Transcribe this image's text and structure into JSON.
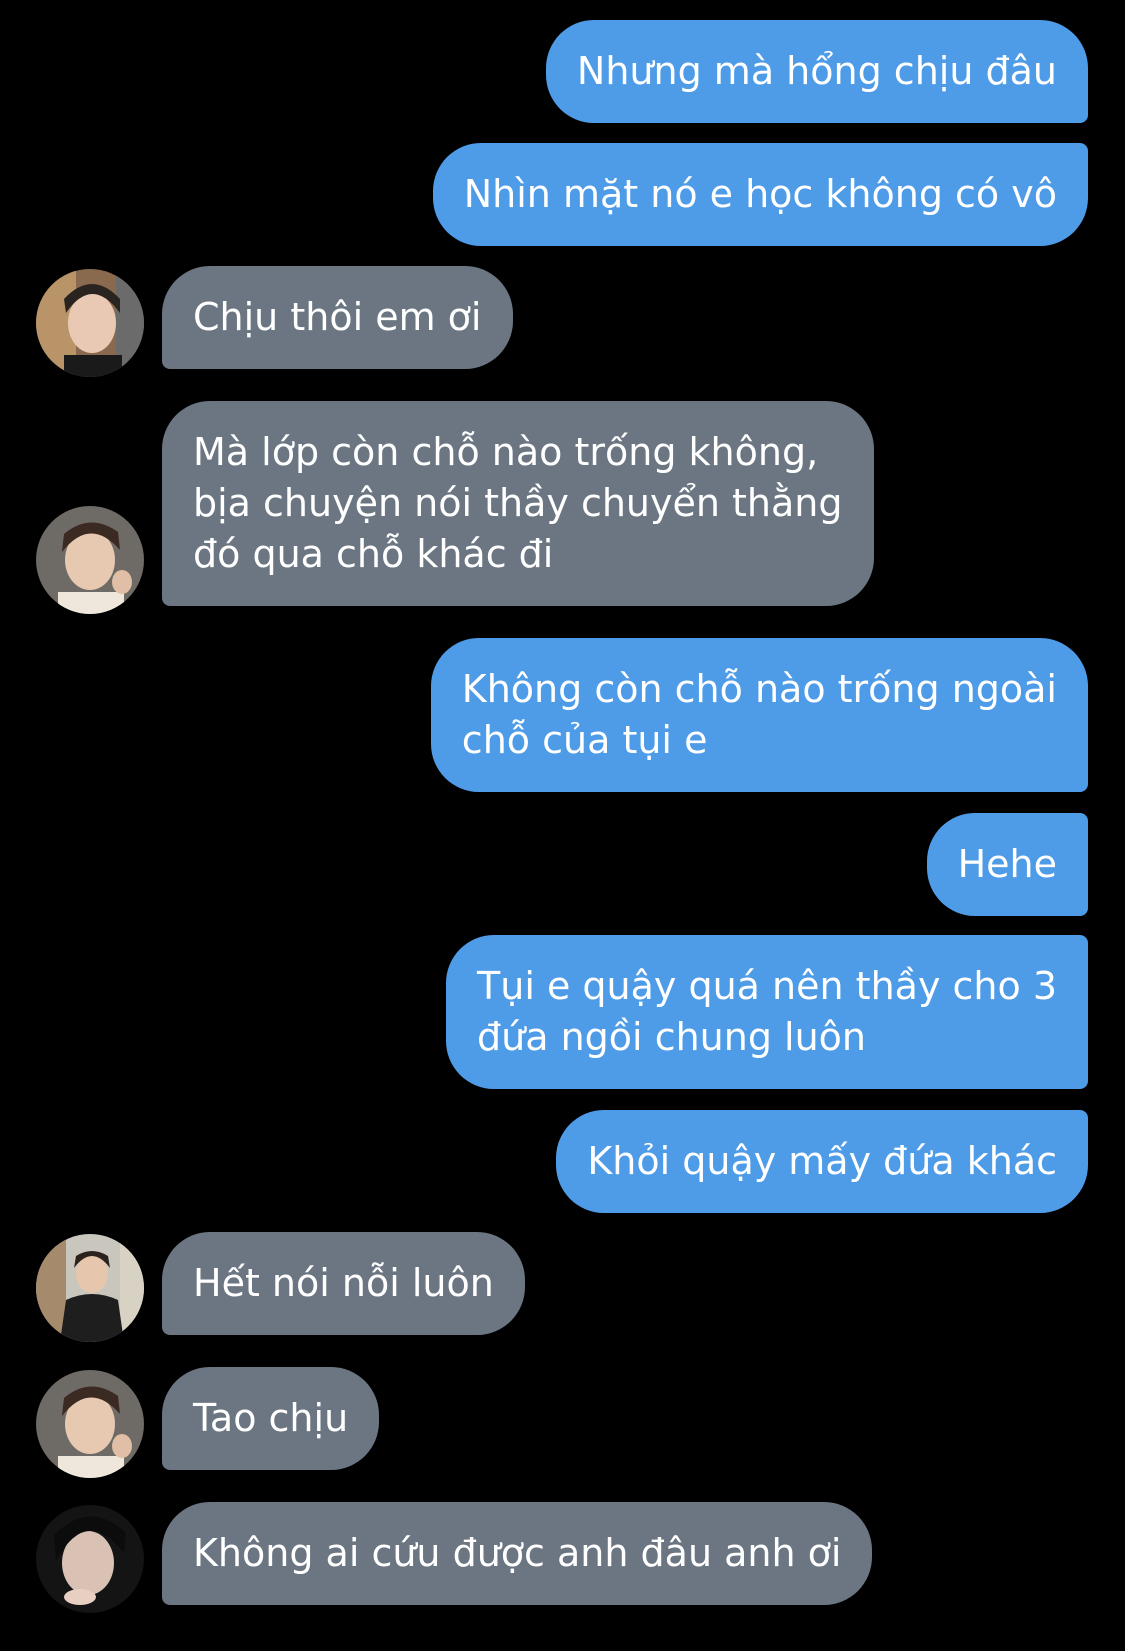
{
  "colors": {
    "background": "#000000",
    "outgoing_bubble": "#4e9be7",
    "incoming_bubble": "#6b7682",
    "text": "#ffffff"
  },
  "messages": [
    {
      "direction": "outgoing",
      "lines": [
        "Nhưng mà hổng chịu đâu"
      ]
    },
    {
      "direction": "outgoing",
      "lines": [
        "Nhìn mặt nó e học không có vô"
      ]
    },
    {
      "direction": "incoming",
      "avatar": "avatar-1-icon",
      "lines": [
        "Chịu thôi em ơi"
      ]
    },
    {
      "direction": "incoming",
      "avatar": "avatar-2-icon",
      "lines": [
        "Mà lớp còn chỗ nào trống không,",
        "bịa chuyện nói thầy chuyển thằng",
        "đó qua chỗ khác đi"
      ]
    },
    {
      "direction": "outgoing",
      "lines": [
        "Không còn chỗ nào trống ngoài",
        "chỗ của tụi e"
      ]
    },
    {
      "direction": "outgoing",
      "lines": [
        "Hehe"
      ]
    },
    {
      "direction": "outgoing",
      "lines": [
        "Tụi e quậy quá nên thầy cho 3",
        "đứa ngồi chung luôn"
      ]
    },
    {
      "direction": "outgoing",
      "lines": [
        "Khỏi quậy mấy đứa khác"
      ]
    },
    {
      "direction": "incoming",
      "avatar": "avatar-3-icon",
      "lines": [
        "Hết nói nỗi luôn"
      ]
    },
    {
      "direction": "incoming",
      "avatar": "avatar-2-icon",
      "lines": [
        "Tao chịu"
      ]
    },
    {
      "direction": "incoming",
      "avatar": "avatar-4-icon",
      "lines": [
        "Không ai cứu được anh đâu anh ơi"
      ]
    }
  ]
}
